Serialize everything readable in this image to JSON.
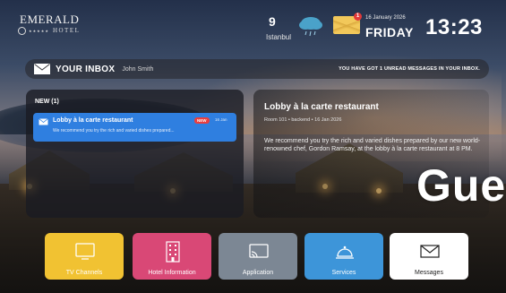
{
  "header": {
    "logo": {
      "brand": "EMERALD",
      "stars": "★★★★★",
      "sub": "HOTEL"
    },
    "weather": {
      "temperature": "9",
      "city": "Istanbul",
      "icon": "rain-cloud-icon"
    },
    "messages": {
      "icon": "envelope-icon",
      "unread_count": "1"
    },
    "date": {
      "full": "16 January 2026",
      "day": "FRIDAY"
    },
    "time": "13:23"
  },
  "inbox": {
    "title": "YOUR INBOX",
    "user": "John Smith",
    "status": "YOU HAVE GOT 1 UNREAD MESSAGES IN YOUR INBOX."
  },
  "list": {
    "header": "NEW (1)",
    "items": [
      {
        "title": "Lobby à la carte restaurant",
        "preview": "We recommend you try the rich and varied dishes prepared...",
        "tag": "NEW",
        "date": "16 Jan"
      }
    ]
  },
  "detail": {
    "title": "Lobby à la carte restaurant",
    "meta": "Room 101 • backend • 16 Jan 2026",
    "body": "We recommend you try the rich and varied dishes prepared by our new world-renowned chef, Gordon Ramsay, at the lobby à la carte restaurant at 8 PM."
  },
  "overlay_text": "Gue",
  "tiles": [
    {
      "label": "TV Channels",
      "icon": "tv-icon",
      "color": "#f1c232"
    },
    {
      "label": "Hotel Information",
      "icon": "building-icon",
      "color": "#d94876"
    },
    {
      "label": "Application",
      "icon": "cast-icon",
      "color": "#7c8794"
    },
    {
      "label": "Services",
      "icon": "service-bell-icon",
      "color": "#3d95d9"
    },
    {
      "label": "Messages",
      "icon": "envelope-icon",
      "color": "#ffffff"
    }
  ]
}
